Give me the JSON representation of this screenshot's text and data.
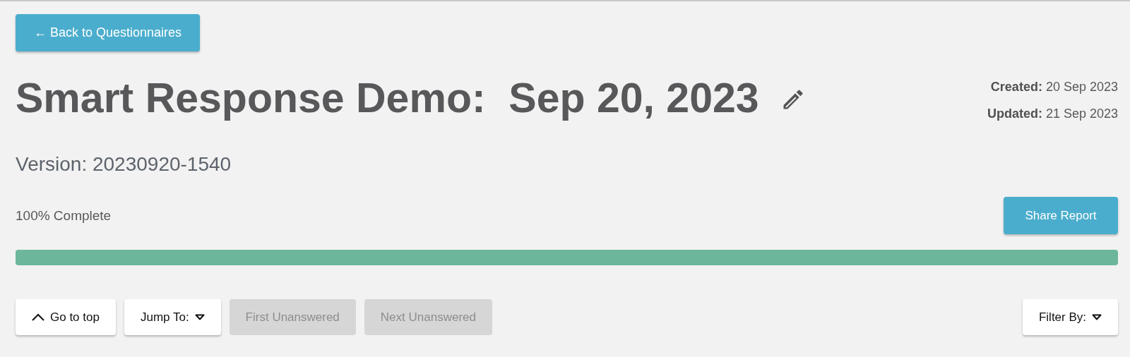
{
  "back_button": {
    "label": "← Back to Questionnaires"
  },
  "title": "Smart Response Demo:  Sep 20, 2023",
  "dates": [
    {
      "label": "Created:",
      "value": "20 Sep 2023"
    },
    {
      "label": "Updated:",
      "value": "21 Sep 2023"
    }
  ],
  "version": "Version: 20230920-1540",
  "progress": {
    "label": "100% Complete",
    "level": 1
  },
  "share_button": {
    "label": "Share Report"
  },
  "toolbar": [
    {
      "kind": "top",
      "label": "Go to top",
      "disabled": false
    },
    {
      "kind": "dropdown",
      "label": "Jump To:",
      "disabled": false
    },
    {
      "kind": "plain",
      "label": "First Unanswered",
      "disabled": true
    },
    {
      "kind": "plain",
      "label": "Next Unanswered",
      "disabled": true
    }
  ],
  "filter_button": {
    "label": "Filter By:"
  }
}
